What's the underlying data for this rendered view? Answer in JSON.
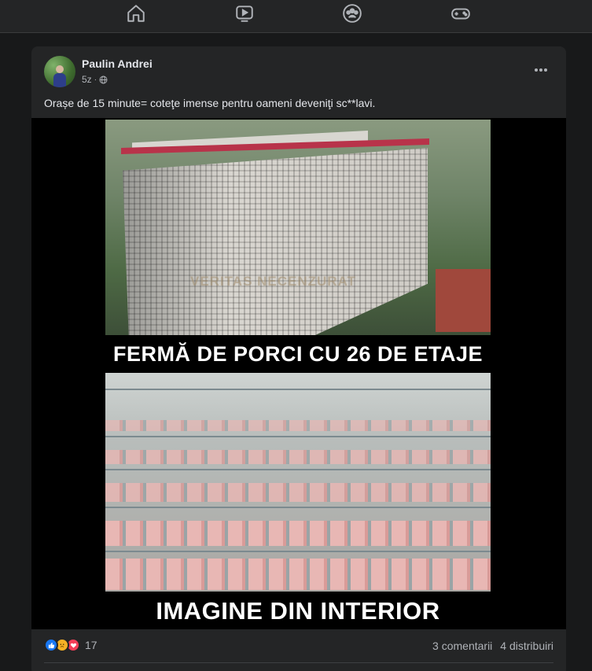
{
  "nav": {
    "items": [
      {
        "icon": "home-icon"
      },
      {
        "icon": "video-icon"
      },
      {
        "icon": "groups-icon"
      },
      {
        "icon": "gaming-icon"
      }
    ]
  },
  "post": {
    "author": "Paulin Andrei",
    "time": "5z",
    "privacy_icon": "globe-icon",
    "caption": "Orașe de 15 minute= coteţe imense pentru oameni deveniţi sc**lavi.",
    "image": {
      "watermark": "VERITAS NECENZURAT",
      "label_top": "FERMĂ DE PORCI CU 26 DE ETAJE",
      "label_bottom": "IMAGINE DIN INTERIOR"
    },
    "reaction_count": "17",
    "comments": "3 comentarii",
    "shares": "4 distribuiri"
  },
  "colors": {
    "background": "#18191a",
    "card": "#242526",
    "text_primary": "#e4e6eb",
    "text_secondary": "#b0b3b8",
    "like": "#1877f2",
    "sad": "#f7b125",
    "love": "#f33e58"
  }
}
